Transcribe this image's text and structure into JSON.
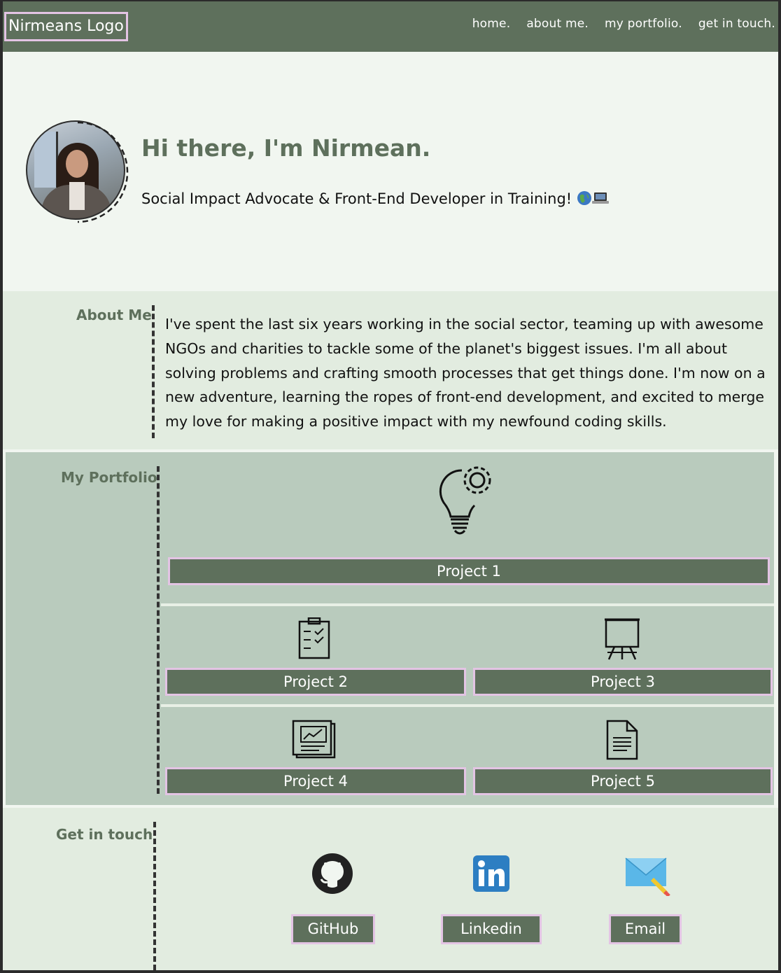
{
  "header": {
    "logo": "Nirmeans Logo",
    "nav": [
      "home.",
      "about me.",
      "my portfolio.",
      "get in touch."
    ]
  },
  "hero": {
    "title": "Hi there, I'm Nirmean.",
    "subtitle": "Social Impact Advocate & Front-End Developer in Training!"
  },
  "about": {
    "label": "About Me",
    "text": "I've spent the last six years working in the social sector, teaming up with awesome NGOs and charities to tackle some of the planet's biggest issues. I'm all about solving problems and crafting smooth processes that get things done. I'm now on a new adventure, learning the ropes of front-end development, and excited to merge my love for making a positive impact with my newfound coding skills."
  },
  "portfolio": {
    "label": "My Portfolio",
    "projects": [
      {
        "label": "Project 1",
        "icon": "lightbulb-gear-icon"
      },
      {
        "label": "Project 2",
        "icon": "clipboard-checklist-icon"
      },
      {
        "label": "Project 3",
        "icon": "presentation-easel-icon"
      },
      {
        "label": "Project 4",
        "icon": "chart-document-icon"
      },
      {
        "label": "Project 5",
        "icon": "document-icon"
      }
    ]
  },
  "contact": {
    "label": "Get in touch",
    "links": [
      {
        "label": "GitHub",
        "icon": "github-icon"
      },
      {
        "label": "Linkedin",
        "icon": "linkedin-icon"
      },
      {
        "label": "Email",
        "icon": "email-icon"
      }
    ]
  },
  "colors": {
    "primary": "#5e705c",
    "accent_border": "#e3c4e4",
    "hero_bg": "#f1f6f0",
    "section_bg": "#e2ece0",
    "portfolio_bg": "#b9cbbd"
  }
}
